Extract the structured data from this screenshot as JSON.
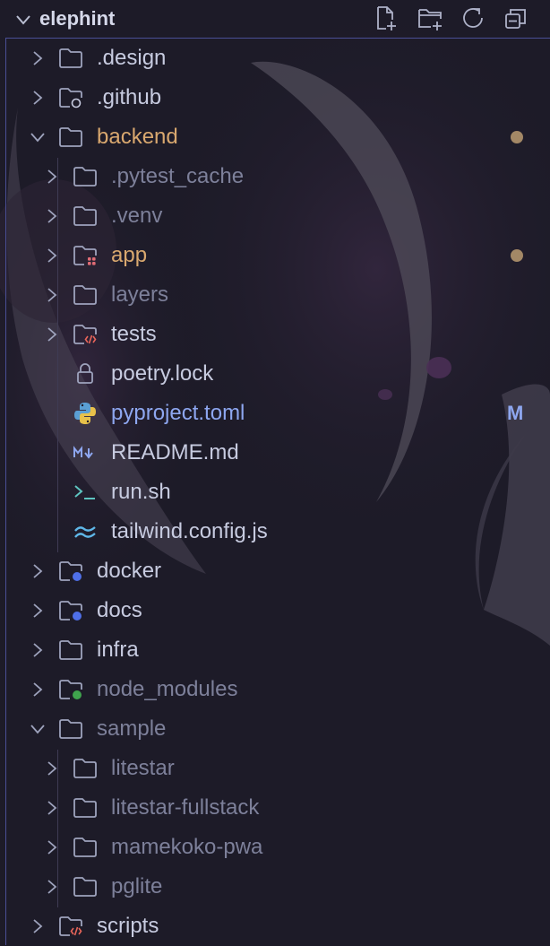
{
  "explorer": {
    "title": "elephint",
    "actions": [
      {
        "name": "new-file-icon"
      },
      {
        "name": "new-folder-icon"
      },
      {
        "name": "refresh-icon"
      },
      {
        "name": "collapse-all-icon"
      }
    ]
  },
  "tree": [
    {
      "label": ".design",
      "type": "folder",
      "depth": 0,
      "expanded": false
    },
    {
      "label": ".github",
      "type": "folder-github",
      "depth": 0,
      "expanded": false
    },
    {
      "label": "backend",
      "type": "folder",
      "depth": 0,
      "expanded": true,
      "status": "modified-dot"
    },
    {
      "label": ".pytest_cache",
      "type": "folder",
      "depth": 1,
      "expanded": false,
      "dim": true
    },
    {
      "label": ".venv",
      "type": "folder",
      "depth": 1,
      "expanded": false,
      "dim": true
    },
    {
      "label": "app",
      "type": "folder-app",
      "depth": 1,
      "expanded": false,
      "status": "modified-dot"
    },
    {
      "label": "layers",
      "type": "folder",
      "depth": 1,
      "expanded": false,
      "dim": true
    },
    {
      "label": "tests",
      "type": "folder-tests",
      "depth": 1,
      "expanded": false
    },
    {
      "label": "poetry.lock",
      "type": "lock",
      "depth": 1
    },
    {
      "label": "pyproject.toml",
      "type": "python",
      "depth": 1,
      "badge": "M"
    },
    {
      "label": "README.md",
      "type": "markdown",
      "depth": 1
    },
    {
      "label": "run.sh",
      "type": "shell",
      "depth": 1
    },
    {
      "label": "tailwind.config.js",
      "type": "tailwind",
      "depth": 1
    },
    {
      "label": "docker",
      "type": "folder-blue",
      "depth": 0,
      "expanded": false
    },
    {
      "label": "docs",
      "type": "folder-blue",
      "depth": 0,
      "expanded": false
    },
    {
      "label": "infra",
      "type": "folder",
      "depth": 0,
      "expanded": false
    },
    {
      "label": "node_modules",
      "type": "folder-green",
      "depth": 0,
      "expanded": false,
      "dim": true
    },
    {
      "label": "sample",
      "type": "folder",
      "depth": 0,
      "expanded": true,
      "dim": true
    },
    {
      "label": "litestar",
      "type": "folder",
      "depth": 1,
      "expanded": false,
      "dim": true
    },
    {
      "label": "litestar-fullstack",
      "type": "folder",
      "depth": 1,
      "expanded": false,
      "dim": true
    },
    {
      "label": "mamekoko-pwa",
      "type": "folder",
      "depth": 1,
      "expanded": false,
      "dim": true
    },
    {
      "label": "pglite",
      "type": "folder",
      "depth": 1,
      "expanded": false,
      "dim": true
    },
    {
      "label": "scripts",
      "type": "folder-tests",
      "depth": 0,
      "expanded": false
    }
  ],
  "colors": {
    "background": "#1c1a27",
    "text": "#c7cbe0",
    "dim_text": "#7d809a",
    "modified_text": "#d9a86f",
    "python_text": "#8ea7f0",
    "modified_dot": "#a38866",
    "focus_border": "#4a4f96"
  }
}
